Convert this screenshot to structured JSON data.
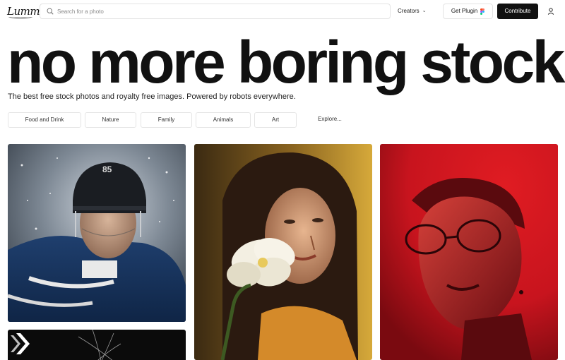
{
  "header": {
    "logo_text": "Lummi",
    "search_placeholder": "Search for a photo",
    "creators_label": "Creators",
    "plugin_label": "Get Plugin",
    "contribute_label": "Contribute",
    "icons": {
      "search": "search-icon",
      "chevron": "chevron-down-icon",
      "figma": "figma-icon",
      "user": "user-icon"
    }
  },
  "hero": {
    "title": "no more boring stock",
    "tagline": "The best free stock photos and royalty free images. Powered by robots everywhere."
  },
  "categories": {
    "items": [
      "Food and Drink",
      "Nature",
      "Family",
      "Animals",
      "Art"
    ],
    "explore_label": "Explore..."
  },
  "photos": [
    {
      "subject": "hockey-player"
    },
    {
      "subject": "woman-with-flower"
    },
    {
      "subject": "red-portrait"
    },
    {
      "subject": "dark-abstract"
    }
  ],
  "colors": {
    "contribute_bg": "#111111",
    "red_photo": "#c8141e"
  }
}
